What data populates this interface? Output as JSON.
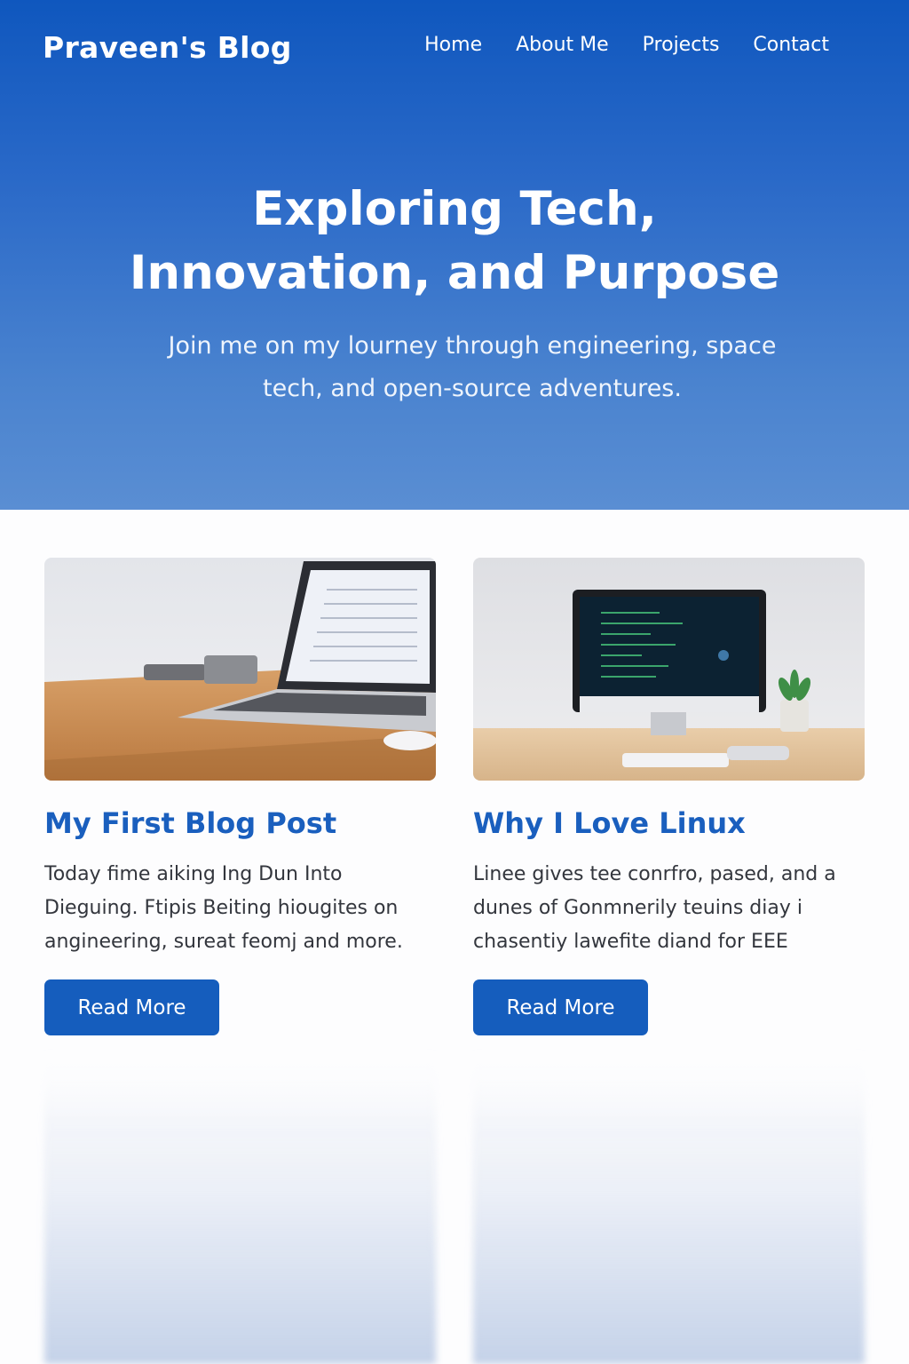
{
  "header": {
    "brand": "Praveen's Blog",
    "nav": [
      "Home",
      "About Me",
      "Projects",
      "Contact"
    ]
  },
  "hero": {
    "title": "Exploring Tech, Innovation, and Purpose",
    "subtitle": "Join me on my lourney through engineering, space tech, and open-source adventures."
  },
  "posts": [
    {
      "title": "My First Blog Post",
      "excerpt": "Today fime aiking Ing Dun Into Dieguing. Ftipis Beiting hiougites on angineering, sureat feomj and more.",
      "button": "Read More",
      "image_icon": "laptop-icon"
    },
    {
      "title": "Why I Love Linux",
      "excerpt": "Linee gives tee conrfro, pased, and a dunes of Gonmnerily teuins diay i chasentiy lawefite diand for EEE",
      "button": "Read More",
      "image_icon": "desktop-monitor-icon"
    }
  ],
  "colors": {
    "hero_top": "#0f57be",
    "hero_bottom": "#5a8ed3",
    "accent": "#1a5fbe",
    "button": "#155dbd"
  }
}
